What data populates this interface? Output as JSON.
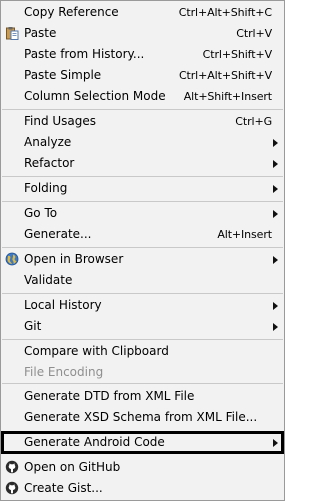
{
  "menu": {
    "copy_reference": {
      "label": "Copy Reference",
      "shortcut": "Ctrl+Alt+Shift+C"
    },
    "paste": {
      "label": "Paste",
      "shortcut": "Ctrl+V",
      "icon": "clipboard-icon"
    },
    "paste_history": {
      "label": "Paste from History...",
      "shortcut": "Ctrl+Shift+V"
    },
    "paste_simple": {
      "label": "Paste Simple",
      "shortcut": "Ctrl+Alt+Shift+V"
    },
    "column_selection": {
      "label": "Column Selection Mode",
      "shortcut": "Alt+Shift+Insert"
    },
    "find_usages": {
      "label": "Find Usages",
      "shortcut": "Ctrl+G"
    },
    "analyze": {
      "label": "Analyze"
    },
    "refactor": {
      "label": "Refactor"
    },
    "folding": {
      "label": "Folding"
    },
    "go_to": {
      "label": "Go To"
    },
    "generate": {
      "label": "Generate...",
      "shortcut": "Alt+Insert"
    },
    "open_in_browser": {
      "label": "Open in Browser",
      "icon": "globe-icon"
    },
    "validate": {
      "label": "Validate"
    },
    "local_history": {
      "label": "Local History"
    },
    "git": {
      "label": "Git"
    },
    "compare_clipboard": {
      "label": "Compare with Clipboard"
    },
    "file_encoding": {
      "label": "File Encoding"
    },
    "generate_dtd": {
      "label": "Generate DTD from XML File"
    },
    "generate_xsd": {
      "label": "Generate XSD Schema from XML File..."
    },
    "generate_android": {
      "label": "Generate Android Code"
    },
    "open_github": {
      "label": "Open on GitHub",
      "icon": "github-icon"
    },
    "create_gist": {
      "label": "Create Gist...",
      "icon": "github-icon"
    }
  }
}
